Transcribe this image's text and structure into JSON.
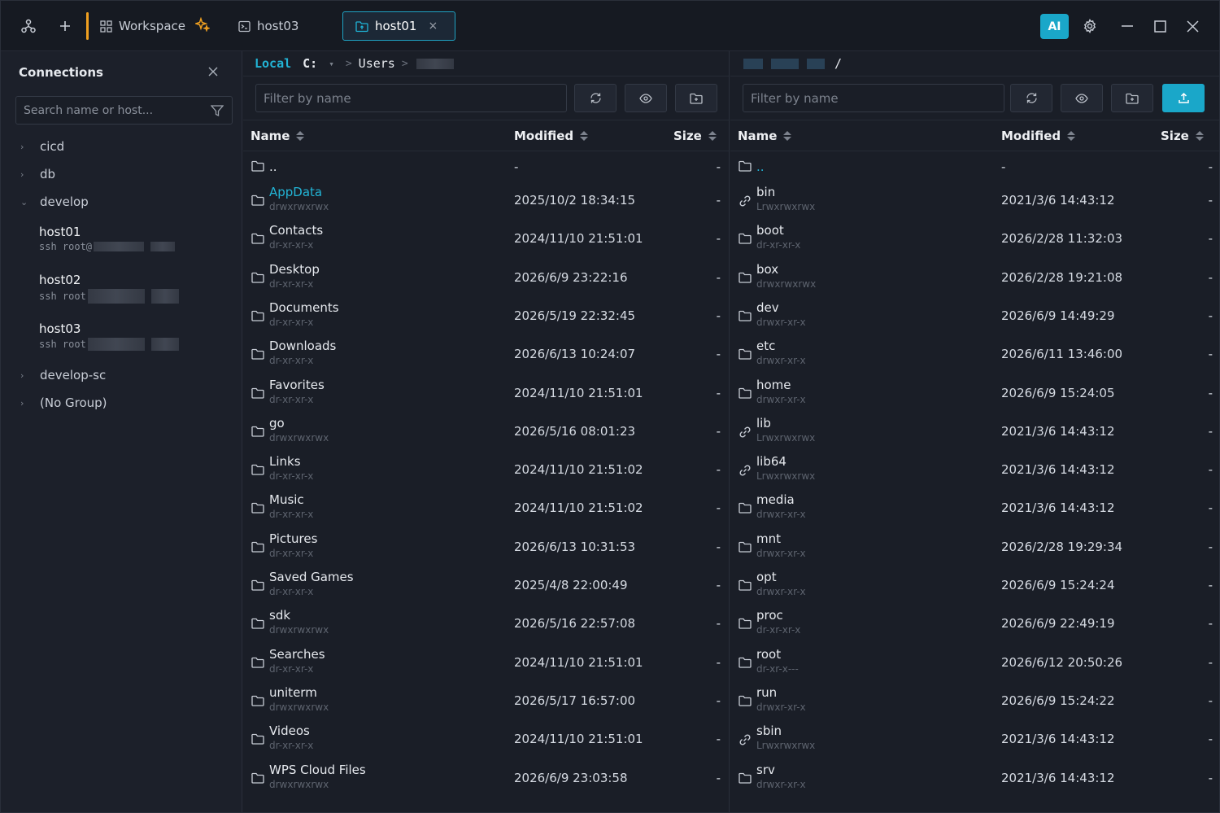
{
  "topbar": {
    "tabs": [
      {
        "label": "Workspace"
      },
      {
        "label": "host03"
      },
      {
        "label": "host01",
        "close": "×"
      }
    ],
    "ai_label": "AI"
  },
  "sidebar": {
    "title": "Connections",
    "search_placeholder": "Search name or host...",
    "groups": [
      {
        "label": "cicd"
      },
      {
        "label": "db"
      },
      {
        "label": "develop"
      },
      {
        "label": "develop-sc"
      },
      {
        "label": "(No Group)"
      }
    ],
    "hosts": [
      {
        "name": "host01",
        "sub": "ssh root@"
      },
      {
        "name": "host02",
        "sub": "ssh root"
      },
      {
        "name": "host03",
        "sub": "ssh root"
      }
    ]
  },
  "local": {
    "path_label": "Local",
    "drive": "C:",
    "crumb": "Users",
    "filter_placeholder": "Filter by name",
    "columns": {
      "name": "Name",
      "modified": "Modified",
      "size": "Size"
    },
    "rows": [
      {
        "name": "..",
        "perm": "",
        "modified": "-",
        "size": "-",
        "icon": "folder"
      },
      {
        "name": "AppData",
        "perm": "drwxrwxrwx",
        "modified": "2025/10/2 18:34:15",
        "size": "-",
        "icon": "folder"
      },
      {
        "name": "Contacts",
        "perm": "dr-xr-xr-x",
        "modified": "2024/11/10 21:51:01",
        "size": "-",
        "icon": "folder"
      },
      {
        "name": "Desktop",
        "perm": "dr-xr-xr-x",
        "modified": "2026/6/9 23:22:16",
        "size": "-",
        "icon": "folder"
      },
      {
        "name": "Documents",
        "perm": "dr-xr-xr-x",
        "modified": "2026/5/19 22:32:45",
        "size": "-",
        "icon": "folder"
      },
      {
        "name": "Downloads",
        "perm": "dr-xr-xr-x",
        "modified": "2026/6/13 10:24:07",
        "size": "-",
        "icon": "folder"
      },
      {
        "name": "Favorites",
        "perm": "dr-xr-xr-x",
        "modified": "2024/11/10 21:51:01",
        "size": "-",
        "icon": "folder"
      },
      {
        "name": "go",
        "perm": "drwxrwxrwx",
        "modified": "2026/5/16 08:01:23",
        "size": "-",
        "icon": "folder"
      },
      {
        "name": "Links",
        "perm": "dr-xr-xr-x",
        "modified": "2024/11/10 21:51:02",
        "size": "-",
        "icon": "folder"
      },
      {
        "name": "Music",
        "perm": "dr-xr-xr-x",
        "modified": "2024/11/10 21:51:02",
        "size": "-",
        "icon": "folder"
      },
      {
        "name": "Pictures",
        "perm": "dr-xr-xr-x",
        "modified": "2026/6/13 10:31:53",
        "size": "-",
        "icon": "folder"
      },
      {
        "name": "Saved Games",
        "perm": "dr-xr-xr-x",
        "modified": "2025/4/8 22:00:49",
        "size": "-",
        "icon": "folder"
      },
      {
        "name": "sdk",
        "perm": "drwxrwxrwx",
        "modified": "2026/5/16 22:57:08",
        "size": "-",
        "icon": "folder"
      },
      {
        "name": "Searches",
        "perm": "dr-xr-xr-x",
        "modified": "2024/11/10 21:51:01",
        "size": "-",
        "icon": "folder"
      },
      {
        "name": "uniterm",
        "perm": "drwxrwxrwx",
        "modified": "2026/5/17 16:57:00",
        "size": "-",
        "icon": "folder"
      },
      {
        "name": "Videos",
        "perm": "dr-xr-xr-x",
        "modified": "2024/11/10 21:51:01",
        "size": "-",
        "icon": "folder"
      },
      {
        "name": "WPS Cloud Files",
        "perm": "drwxrwxrwx",
        "modified": "2026/6/9 23:03:58",
        "size": "-",
        "icon": "folder"
      }
    ]
  },
  "remote": {
    "path": "/",
    "filter_placeholder": "Filter by name",
    "columns": {
      "name": "Name",
      "modified": "Modified",
      "size": "Size"
    },
    "rows": [
      {
        "name": "..",
        "perm": "",
        "modified": "-",
        "size": "-",
        "icon": "folder"
      },
      {
        "name": "bin",
        "perm": "Lrwxrwxrwx",
        "modified": "2021/3/6 14:43:12",
        "size": "-",
        "icon": "link"
      },
      {
        "name": "boot",
        "perm": "dr-xr-xr-x",
        "modified": "2026/2/28 11:32:03",
        "size": "-",
        "icon": "folder"
      },
      {
        "name": "box",
        "perm": "drwxrwxrwx",
        "modified": "2026/2/28 19:21:08",
        "size": "-",
        "icon": "folder"
      },
      {
        "name": "dev",
        "perm": "drwxr-xr-x",
        "modified": "2026/6/9 14:49:29",
        "size": "-",
        "icon": "folder"
      },
      {
        "name": "etc",
        "perm": "drwxr-xr-x",
        "modified": "2026/6/11 13:46:00",
        "size": "-",
        "icon": "folder"
      },
      {
        "name": "home",
        "perm": "drwxr-xr-x",
        "modified": "2026/6/9 15:24:05",
        "size": "-",
        "icon": "folder"
      },
      {
        "name": "lib",
        "perm": "Lrwxrwxrwx",
        "modified": "2021/3/6 14:43:12",
        "size": "-",
        "icon": "link"
      },
      {
        "name": "lib64",
        "perm": "Lrwxrwxrwx",
        "modified": "2021/3/6 14:43:12",
        "size": "-",
        "icon": "link"
      },
      {
        "name": "media",
        "perm": "drwxr-xr-x",
        "modified": "2021/3/6 14:43:12",
        "size": "-",
        "icon": "folder"
      },
      {
        "name": "mnt",
        "perm": "drwxr-xr-x",
        "modified": "2026/2/28 19:29:34",
        "size": "-",
        "icon": "folder"
      },
      {
        "name": "opt",
        "perm": "drwxr-xr-x",
        "modified": "2026/6/9 15:24:24",
        "size": "-",
        "icon": "folder"
      },
      {
        "name": "proc",
        "perm": "dr-xr-xr-x",
        "modified": "2026/6/9 22:49:19",
        "size": "-",
        "icon": "folder"
      },
      {
        "name": "root",
        "perm": "dr-xr-x---",
        "modified": "2026/6/12 20:50:26",
        "size": "-",
        "icon": "folder"
      },
      {
        "name": "run",
        "perm": "drwxr-xr-x",
        "modified": "2026/6/9 15:24:22",
        "size": "-",
        "icon": "folder"
      },
      {
        "name": "sbin",
        "perm": "Lrwxrwxrwx",
        "modified": "2021/3/6 14:43:12",
        "size": "-",
        "icon": "link"
      },
      {
        "name": "srv",
        "perm": "drwxr-xr-x",
        "modified": "2021/3/6 14:43:12",
        "size": "-",
        "icon": "folder"
      }
    ]
  },
  "colors": {
    "accent": "#1aa7c9",
    "workspace_bar": "#f0a020",
    "sparkle": "#f0a020"
  }
}
